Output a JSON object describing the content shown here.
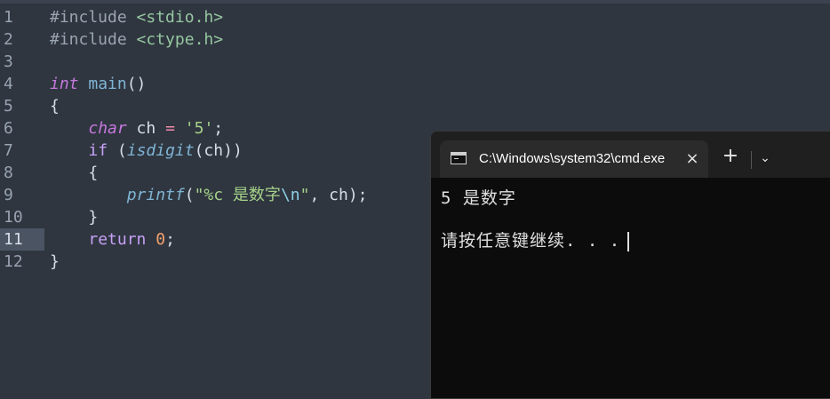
{
  "editor": {
    "line_numbers": [
      "1",
      "2",
      "3",
      "4",
      "5",
      "6",
      "7",
      "8",
      "9",
      "10",
      "11",
      "12"
    ],
    "active_line": "11",
    "lines": {
      "l1": {
        "directive": "#include",
        "header": "<stdio.h>"
      },
      "l2": {
        "directive": "#include",
        "header": "<ctype.h>"
      },
      "l4": {
        "type": "int",
        "name": "main",
        "parens": "()"
      },
      "l5": {
        "brace": "{"
      },
      "l6": {
        "type": "char",
        "var": " ch ",
        "op": "=",
        "sp": " ",
        "str": "'5'",
        "semi": ";"
      },
      "l7": {
        "kw": "if",
        "open": " (",
        "fn": "isdigit",
        "args": "(ch))"
      },
      "l8": {
        "brace": "{"
      },
      "l9": {
        "fn": "printf",
        "open": "(",
        "str_a": "\"%c 是数字",
        "esc": "\\n",
        "str_b": "\"",
        "rest": ", ch);"
      },
      "l10": {
        "brace": "}"
      },
      "l11": {
        "kw": "return",
        "sp": " ",
        "num": "0",
        "semi": ";"
      },
      "l12": {
        "brace": "}"
      }
    }
  },
  "terminal": {
    "tab_title": "C:\\Windows\\system32\\cmd.exe",
    "close_icon": "×",
    "new_tab_icon": "+",
    "dropdown_icon": "⌄",
    "output": [
      "5 是数字",
      "请按任意键继续. . ."
    ]
  },
  "colors": {
    "editor_bg": "#2f3640",
    "terminal_bg": "#0c0c0c",
    "titlebar_bg": "#1f1f1f"
  }
}
